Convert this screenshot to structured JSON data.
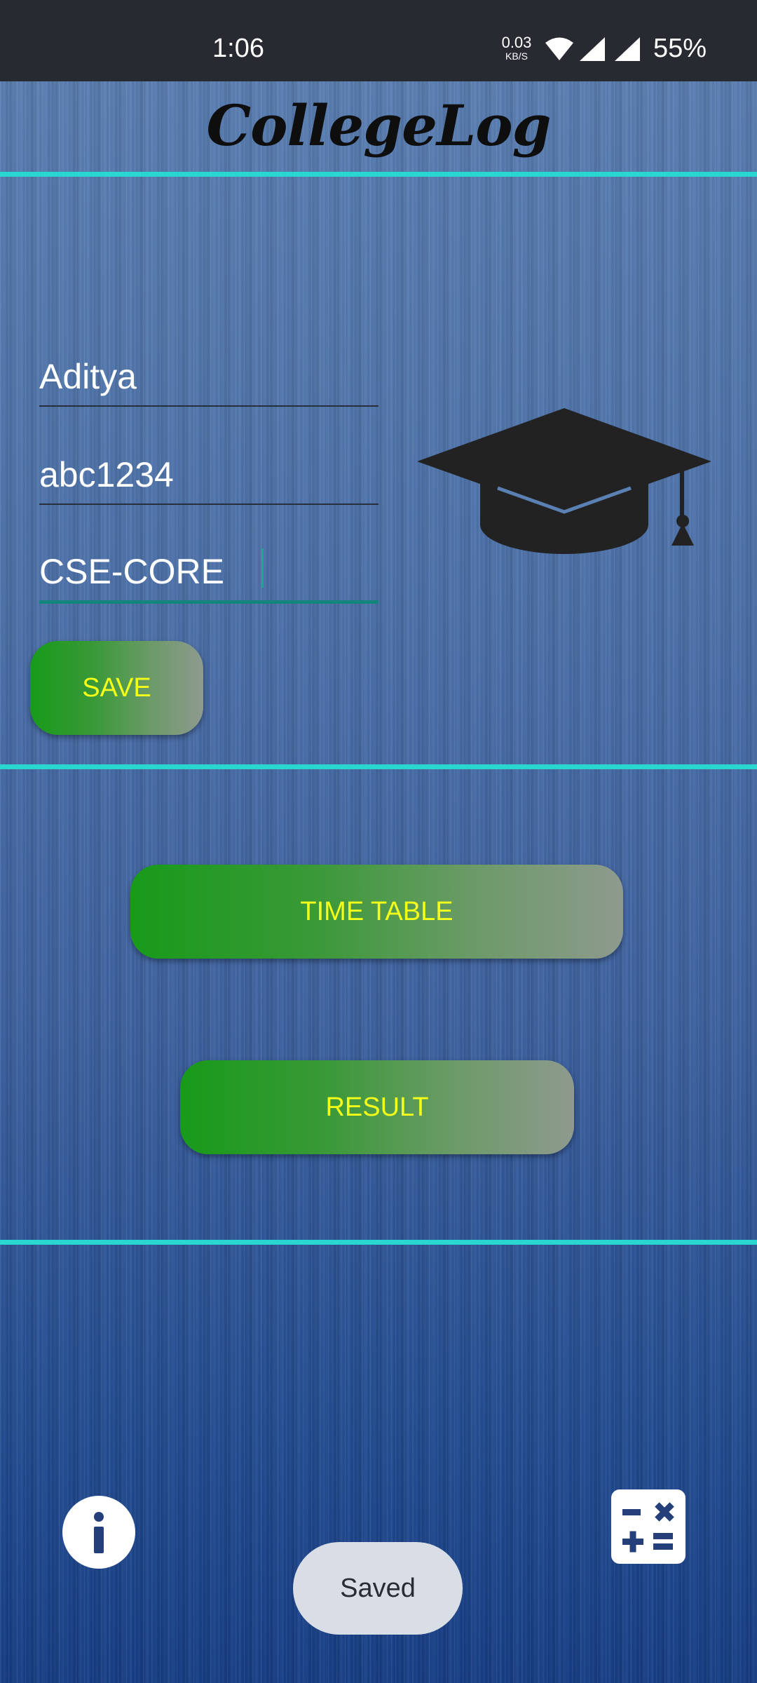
{
  "status_bar": {
    "time": "1:06",
    "net_speed_value": "0.03",
    "net_speed_unit": "KB/S",
    "battery": "55%"
  },
  "app": {
    "title": "CollegeLog"
  },
  "form": {
    "name_value": "Aditya",
    "id_value": "abc1234",
    "department_value": "CSE-CORE",
    "save_label": "SAVE"
  },
  "menu": {
    "time_table_label": "TIME TABLE",
    "result_label": "RESULT"
  },
  "toast": {
    "message": "Saved"
  },
  "colors": {
    "divider": "#2ad7d0",
    "button_text": "#f4ff1a",
    "button_gradient_start": "#189a1a",
    "button_gradient_end": "#8e9a8e",
    "background_top": "#5b80b3",
    "background_bottom": "#173e86"
  },
  "icons": {
    "graduation_cap": "graduation-cap-icon",
    "info": "info-icon",
    "calculator": "calculator-icon",
    "wifi": "wifi-icon",
    "signal": "signal-icon"
  }
}
